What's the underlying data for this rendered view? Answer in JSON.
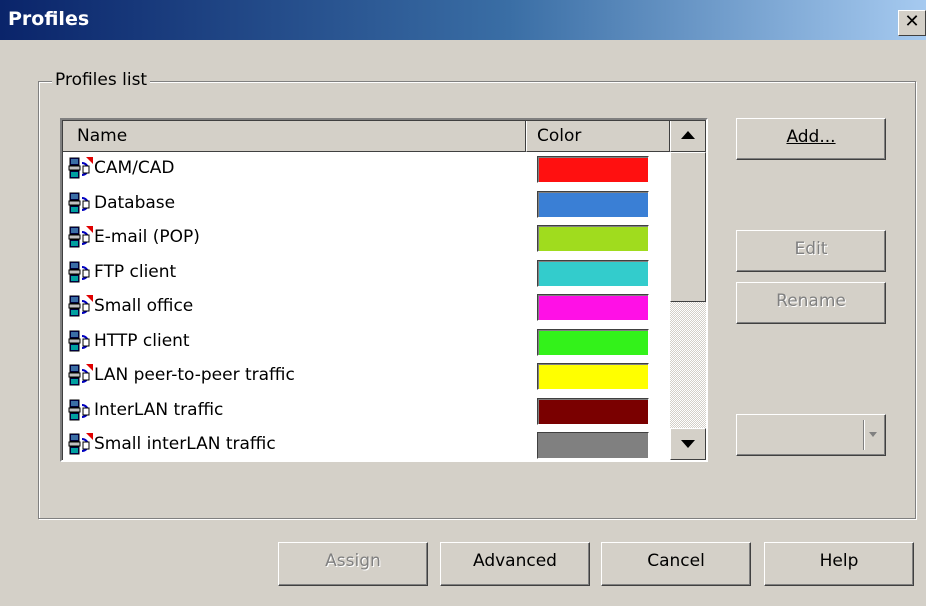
{
  "window": {
    "title": "Profiles",
    "close_glyph": "✕"
  },
  "group": {
    "title": "Profiles list"
  },
  "list": {
    "columns": [
      "Name",
      "Color"
    ],
    "rows": [
      {
        "name": "CAM/CAD",
        "color": "#ff1010",
        "icon": "profile-icon"
      },
      {
        "name": "Database",
        "color": "#3a7fd5",
        "icon": "profile-icon"
      },
      {
        "name": "E-mail (POP)",
        "color": "#a0dc1e",
        "icon": "profile-icon"
      },
      {
        "name": "FTP client",
        "color": "#33cccc",
        "icon": "profile-icon"
      },
      {
        "name": "Small office",
        "color": "#ff10e6",
        "icon": "profile-icon"
      },
      {
        "name": "HTTP client",
        "color": "#33f21a",
        "icon": "profile-icon"
      },
      {
        "name": "LAN peer-to-peer traffic",
        "color": "#ffff00",
        "icon": "profile-icon"
      },
      {
        "name": "InterLAN traffic",
        "color": "#7a0000",
        "icon": "profile-icon"
      },
      {
        "name": "Small interLAN traffic",
        "color": "#808080",
        "icon": "profile-icon"
      }
    ]
  },
  "buttons": {
    "add": {
      "label": "Add...",
      "enabled": true
    },
    "edit": {
      "label": "Edit",
      "enabled": false
    },
    "rename": {
      "label": "Rename",
      "enabled": false
    },
    "assign": {
      "label": "Assign",
      "enabled": false
    },
    "advanced": {
      "label": "Advanced",
      "enabled": true
    },
    "cancel": {
      "label": "Cancel",
      "enabled": true
    },
    "help": {
      "label": "Help",
      "enabled": true
    }
  },
  "combo": {
    "value": ""
  }
}
